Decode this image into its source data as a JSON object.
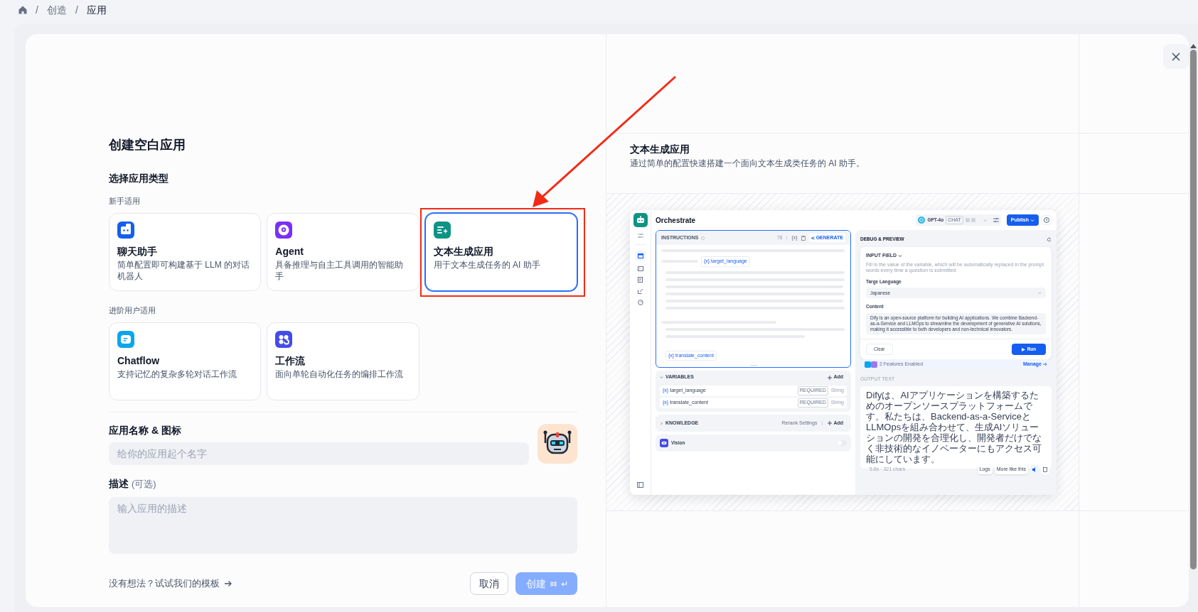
{
  "breadcrumb": [
    {
      "separator": "/",
      "label": "创造",
      "selected": false
    },
    {
      "separator": "/",
      "label": "应用",
      "selected": true
    }
  ],
  "dialog": {
    "title": "创建空白应用",
    "section_label": "选择应用类型",
    "groups": [
      {
        "label": "新手适用",
        "types": [
          {
            "kind": "chat",
            "name": "聊天助手",
            "description": "简单配置即可构建基于 LLM 的对话机器人",
            "color": "#155eef",
            "selected": false
          },
          {
            "kind": "agent",
            "name": "Agent",
            "description": "具备推理与自主工具调用的智能助手",
            "color": "#7a2ff7",
            "selected": false
          },
          {
            "kind": "completion",
            "name": "文本生成应用",
            "description": "用于文本生成任务的 AI 助手",
            "color": "#0e9384",
            "selected": true
          }
        ]
      },
      {
        "label": "进阶用户适用",
        "types": [
          {
            "kind": "chatflow",
            "name": "Chatflow",
            "description": "支持记忆的复杂多轮对话工作流",
            "color": "#0ba5ec",
            "selected": false
          },
          {
            "kind": "workflow",
            "name": "工作流",
            "description": "面向单轮自动化任务的编排工作流",
            "color": "#444ce7",
            "selected": false
          }
        ]
      }
    ],
    "name_label": "应用名称 & 图标",
    "name_field": {
      "placeholder": "给你的应用起个名字"
    },
    "description_label": "描述",
    "description_optional": "(可选)",
    "description_field": {
      "placeholder": "输入应用的描述"
    },
    "template_link": "没有想法？试试我们的模板",
    "cancel": "取消",
    "create": {
      "label": "创建",
      "disabled": true
    }
  },
  "preview": {
    "title": "文本生成应用",
    "description": "通过简单的配置快速搭建一个面向文本生成类任务的 AI 助手。",
    "screenshot": {
      "title": "Orchestrate",
      "model": "GPT-4o",
      "model_tag": "CHAT",
      "publish": "Publish",
      "instructions": {
        "label": "INSTRUCTIONS",
        "count": "78",
        "marker": "{x}",
        "generate": "GENERATE",
        "chips": [
          {
            "marker": "{x}",
            "name": "target_language"
          },
          {
            "marker": "{x}",
            "name": "translate_content"
          }
        ]
      },
      "variables": {
        "label": "VARIABLES",
        "add": "Add",
        "expanded": true,
        "rows": [
          {
            "marker": "{x}",
            "name": "target_language",
            "badge": "REQUIRED",
            "type": "String"
          },
          {
            "marker": "{x}",
            "name": "translate_content",
            "badge": "REQUIRED",
            "type": "String"
          }
        ]
      },
      "knowledge": {
        "label": "KNOWLEDGE",
        "rerank": "Rerank Settings",
        "add": "Add",
        "expanded": false
      },
      "vision": {
        "label": "Vision",
        "on": false
      },
      "debug": {
        "title": "DEBUG & PREVIEW",
        "input_label": "INPUT FIELD",
        "hint": "Fill in the value of the variable, which will be automatically replaced in the prompt words every time a question is submitted.",
        "fields": [
          {
            "kind": "select",
            "label": "Targe Language",
            "value": "Japanese"
          },
          {
            "kind": "textarea",
            "label": "Content",
            "value": "Dify is an open-source platform for building AI applications. We combine Backend-as-a-Service and LLMOps to streamline the development of generative AI solutions, making it accessible to both developers and non-technical innovators."
          }
        ],
        "clear": "Clear",
        "run": "Run",
        "features": "2 Features Enabled",
        "manage": "Manage",
        "output_label": "OUTPUT TEXT",
        "output": "Difyは、AIアプリケーションを構築するためのオープンソースプラットフォームです。私たちは、Backend-as-a-ServiceとLLMOpsを組み合わせて、生成AIソリューションの開発を合理化し、開発者だけでなく非技術的なイノベーターにもアクセス可能にしています。",
        "stats": "5.8s · 321 chars",
        "logs": "Logs",
        "more": "More like this"
      }
    }
  }
}
